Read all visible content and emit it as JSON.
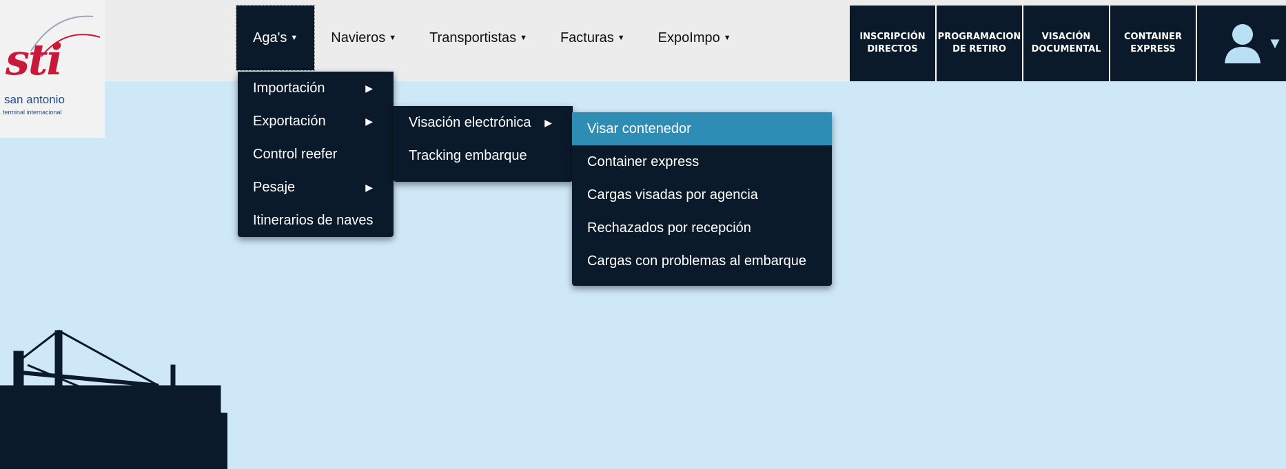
{
  "logo": {
    "main": "sti",
    "sub": "san antonio",
    "sub2": "terminal internacional"
  },
  "nav": [
    {
      "label": "Aga's",
      "active": true
    },
    {
      "label": "Navieros"
    },
    {
      "label": "Transportistas"
    },
    {
      "label": "Facturas"
    },
    {
      "label": "ExpoImpo"
    }
  ],
  "quick": [
    {
      "label": "INSCRIPCIÓN\nDIRECTOS"
    },
    {
      "label": "PROGRAMACION\nDE RETIRO"
    },
    {
      "label": "VISACIÓN\nDOCUMENTAL"
    },
    {
      "label": "CONTAINER\nEXPRESS"
    }
  ],
  "menu1": [
    {
      "label": "Importación",
      "sub": true
    },
    {
      "label": "Exportación",
      "sub": true
    },
    {
      "label": "Control reefer"
    },
    {
      "label": "Pesaje",
      "sub": true
    },
    {
      "label": "Itinerarios de naves"
    }
  ],
  "menu2": [
    {
      "label": "Visación electrónica",
      "sub": true
    },
    {
      "label": "Tracking embarque"
    }
  ],
  "menu3": [
    {
      "label": "Visar contenedor",
      "selected": true
    },
    {
      "label": "Container express"
    },
    {
      "label": "Cargas visadas por agencia"
    },
    {
      "label": "Rechazados por recepción"
    },
    {
      "label": "Cargas con problemas al embarque"
    }
  ],
  "colors": {
    "nav_dark": "#0b1a2a",
    "highlight": "#2e8db5",
    "background": "#cfe8f8"
  },
  "icons": {
    "submenu": "triangle-right",
    "dropdown": "triangle-down",
    "user": "user-silhouette"
  }
}
